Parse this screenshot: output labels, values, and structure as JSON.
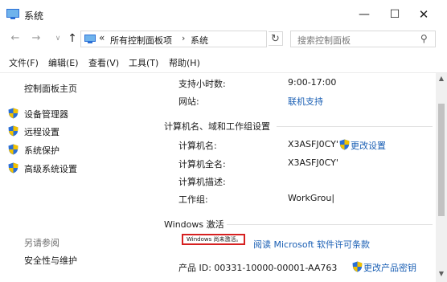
{
  "window": {
    "title": "系统",
    "controls": {
      "minimize": "—",
      "maximize": "☐",
      "close": "✕"
    }
  },
  "nav": {
    "back": "←",
    "forward": "→",
    "recent": "∨",
    "up": "↑",
    "address": {
      "chevron": "«",
      "crumb1": "所有控制面板项",
      "separator": "›",
      "crumb2": "系统",
      "dropdown": "∨"
    },
    "refresh": "↻",
    "search_placeholder": "搜索控制面板"
  },
  "menu": [
    "文件(F)",
    "编辑(E)",
    "查看(V)",
    "工具(T)",
    "帮助(H)"
  ],
  "sidebar": {
    "home": "控制面板主页",
    "links": [
      "设备管理器",
      "远程设置",
      "系统保护",
      "高级系统设置"
    ],
    "see_also": "另请参阅",
    "security": "安全性与维护"
  },
  "support": {
    "hours_label": "支持小时数:",
    "hours_value": "9:00-17:00",
    "website_label": "网站:",
    "website_value": "联机支持"
  },
  "computer": {
    "section_title": "计算机名、域和工作组设置",
    "name_label": "计算机名:",
    "name_value": "X3ASFJ0CY'",
    "change_settings": "更改设置",
    "fullname_label": "计算机全名:",
    "fullname_value": "X3ASFJ0CY'",
    "desc_label": "计算机描述:",
    "workgroup_label": "工作组:",
    "workgroup_value": "WorkGrou|"
  },
  "activation": {
    "section_title": "Windows 激活",
    "status": "Windows 尚未激活。",
    "license_link": "阅读 Microsoft 软件许可条款",
    "product_id": "产品 ID: 00331-10000-00001-AA763",
    "change_key": "更改产品密钥"
  },
  "colors": {
    "link": "#1a5fb4",
    "activation_border": "#d62020",
    "shield_blue": "#2b6fd6",
    "shield_yellow": "#f2c200"
  }
}
